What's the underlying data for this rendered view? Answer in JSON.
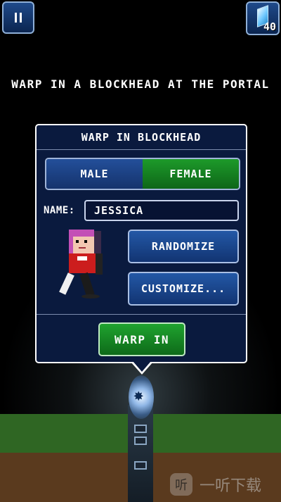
{
  "hud": {
    "gem_count": "40"
  },
  "instruction": "WARP IN A BLOCKHEAD AT THE PORTAL",
  "dialog": {
    "title": "WARP IN BLOCKHEAD",
    "gender": {
      "male_label": "MALE",
      "female_label": "FEMALE",
      "selected": "FEMALE"
    },
    "name_label": "NAME:",
    "name_value": "JESSICA",
    "randomize_label": "RANDOMIZE",
    "customize_label": "CUSTOMIZE...",
    "warp_label": "WARP IN"
  },
  "watermark": {
    "logo_char": "听",
    "text": "一听下载"
  },
  "colors": {
    "selected_toggle": "#1d9a2a",
    "button_blue": "#2358a6",
    "dialog_bg": "#0a1a3e"
  }
}
